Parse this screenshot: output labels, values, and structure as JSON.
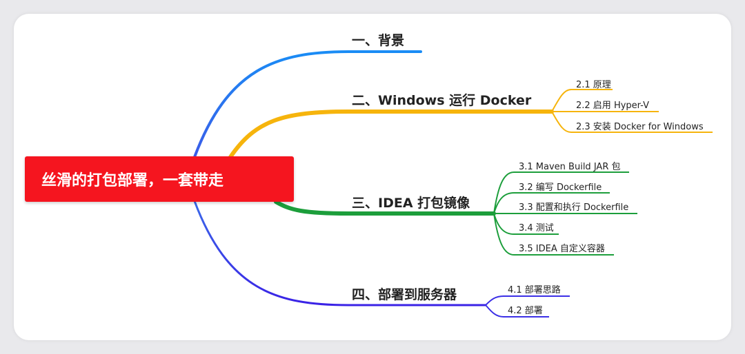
{
  "root": {
    "label": "丝滑的打包部署，一套带走",
    "color": "#f5151f"
  },
  "branches": [
    {
      "label": "一、背景",
      "color": "#2a74f0",
      "children": []
    },
    {
      "label": "二、Windows 运行 Docker",
      "color": "#f6b40c",
      "children": [
        "2.1 原理",
        "2.2 启用 Hyper-V",
        "2.3 安装 Docker for Windows"
      ]
    },
    {
      "label": "三、IDEA 打包镜像",
      "color": "#1c9e3b",
      "children": [
        "3.1 Maven Build JAR 包",
        "3.2 编写 Dockerfile",
        "3.3 配置和执行 Dockerfile",
        "3.4 测试",
        "3.5 IDEA 自定义容器"
      ]
    },
    {
      "label": "四、部署到服务器",
      "color": "#3b2fe6",
      "children": [
        "4.1 部署思路",
        "4.2 部署"
      ]
    }
  ]
}
